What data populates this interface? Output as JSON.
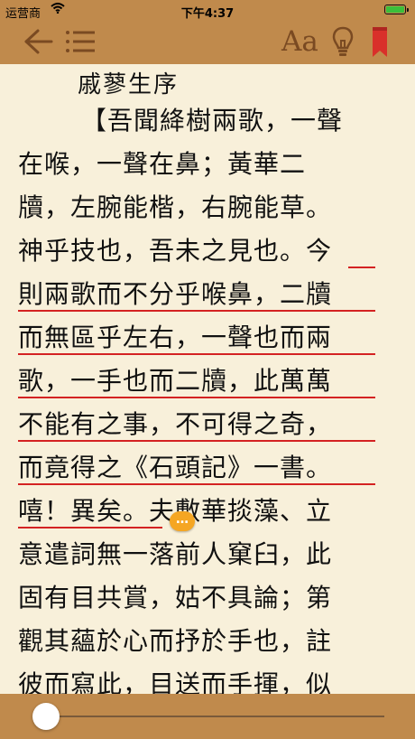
{
  "status": {
    "carrier": "运营商",
    "time": "下午4:37",
    "battery": 1.0
  },
  "toolbar": {
    "back_icon": "back-arrow-icon",
    "toc_icon": "list-icon",
    "font_label": "Aa",
    "bulb_icon": "lightbulb-icon",
    "bookmark_icon": "bookmark-icon",
    "accent_color": "#7a4a22",
    "bar_color": "#c08a4c"
  },
  "content": {
    "title": "戚蓼生序",
    "lines": [
      "【吾聞絳樹兩歌，一聲",
      "在喉，一聲在鼻；黃華二",
      "牘，左腕能楷，右腕能草。",
      "神乎技也，吾未之見也。今",
      "則兩歌而不分乎喉鼻，二牘",
      "而無區乎左右，一聲也而兩",
      "歌，一手也而二牘，此萬萬",
      "不能有之事，不可得之奇，",
      "而竟得之《石頭記》一書。",
      "嘻！異矣。夫敷華掞藻、立",
      "意遣詞無一落前人窠臼，此",
      "固有目共賞，姑不具論；第",
      "觀其蘊於心而抒於手也，註",
      "彼而寫此，目送而手揮，似"
    ],
    "highlight_color": "#d42222",
    "note_marker": "…"
  },
  "progress": {
    "value": 0.0
  }
}
